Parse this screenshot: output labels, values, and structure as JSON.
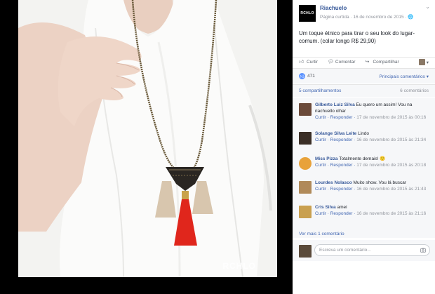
{
  "post": {
    "logo_text": "RCHLO",
    "page_name": "Riachuelo",
    "meta": "Página curtida · 16 de novembro de 2015 · ",
    "text": "Um toque étnico para tirar o seu look do lugar-comum. (colar longo R$ 29,90)",
    "watermark": "RCHLO"
  },
  "actions": {
    "like": "Curtir",
    "comment": "Comentar",
    "share": "Compartilhar"
  },
  "reactions": {
    "count": "471",
    "sort_label": "Principais comentários ▾"
  },
  "shares": {
    "shares": "5 compartilhamentos",
    "comments": "6 comentários"
  },
  "comments": [
    {
      "name": "Gilberto Luiz Silva",
      "text": "Eu quero um assim! Vou na riachuello olhar",
      "links": "Curtir · Responder · ",
      "time": "17 de novembro de 2015 às 00:16",
      "avatar_color": "#6b4a3a"
    },
    {
      "name": "Solange Silva Leite",
      "text": "Lindo",
      "links": "Curtir · Responder · ",
      "time": "16 de novembro de 2015 às 21:34",
      "avatar_color": "#3a2e26"
    },
    {
      "name": "Miss Pizza",
      "text": "Totalmente demais! 🙂",
      "links": "Curtir · Responder · ",
      "time": "17 de novembro de 2015 às 20:18",
      "avatar_color": "#e8a23a"
    },
    {
      "name": "Lourdes Nolasco",
      "text": "Muito show. Vou lá buscar",
      "links": "Curtir · Responder · ",
      "time": "16 de novembro de 2015 às 21:43",
      "avatar_color": "#b08a5a"
    },
    {
      "name": "Cris Silva",
      "text": "amei",
      "links": "Curtir · Responder · ",
      "time": "16 de novembro de 2015 às 21:16",
      "avatar_color": "#c9a050"
    }
  ],
  "view_more": "Ver mais 1 comentário",
  "composer": {
    "placeholder": "Escreva um comentário..."
  },
  "colors": {
    "link": "#365899",
    "accent": "#4267b2",
    "muted": "#90949c",
    "tassel_red": "#e0261c",
    "tassel_beige": "#d8c6ae"
  }
}
